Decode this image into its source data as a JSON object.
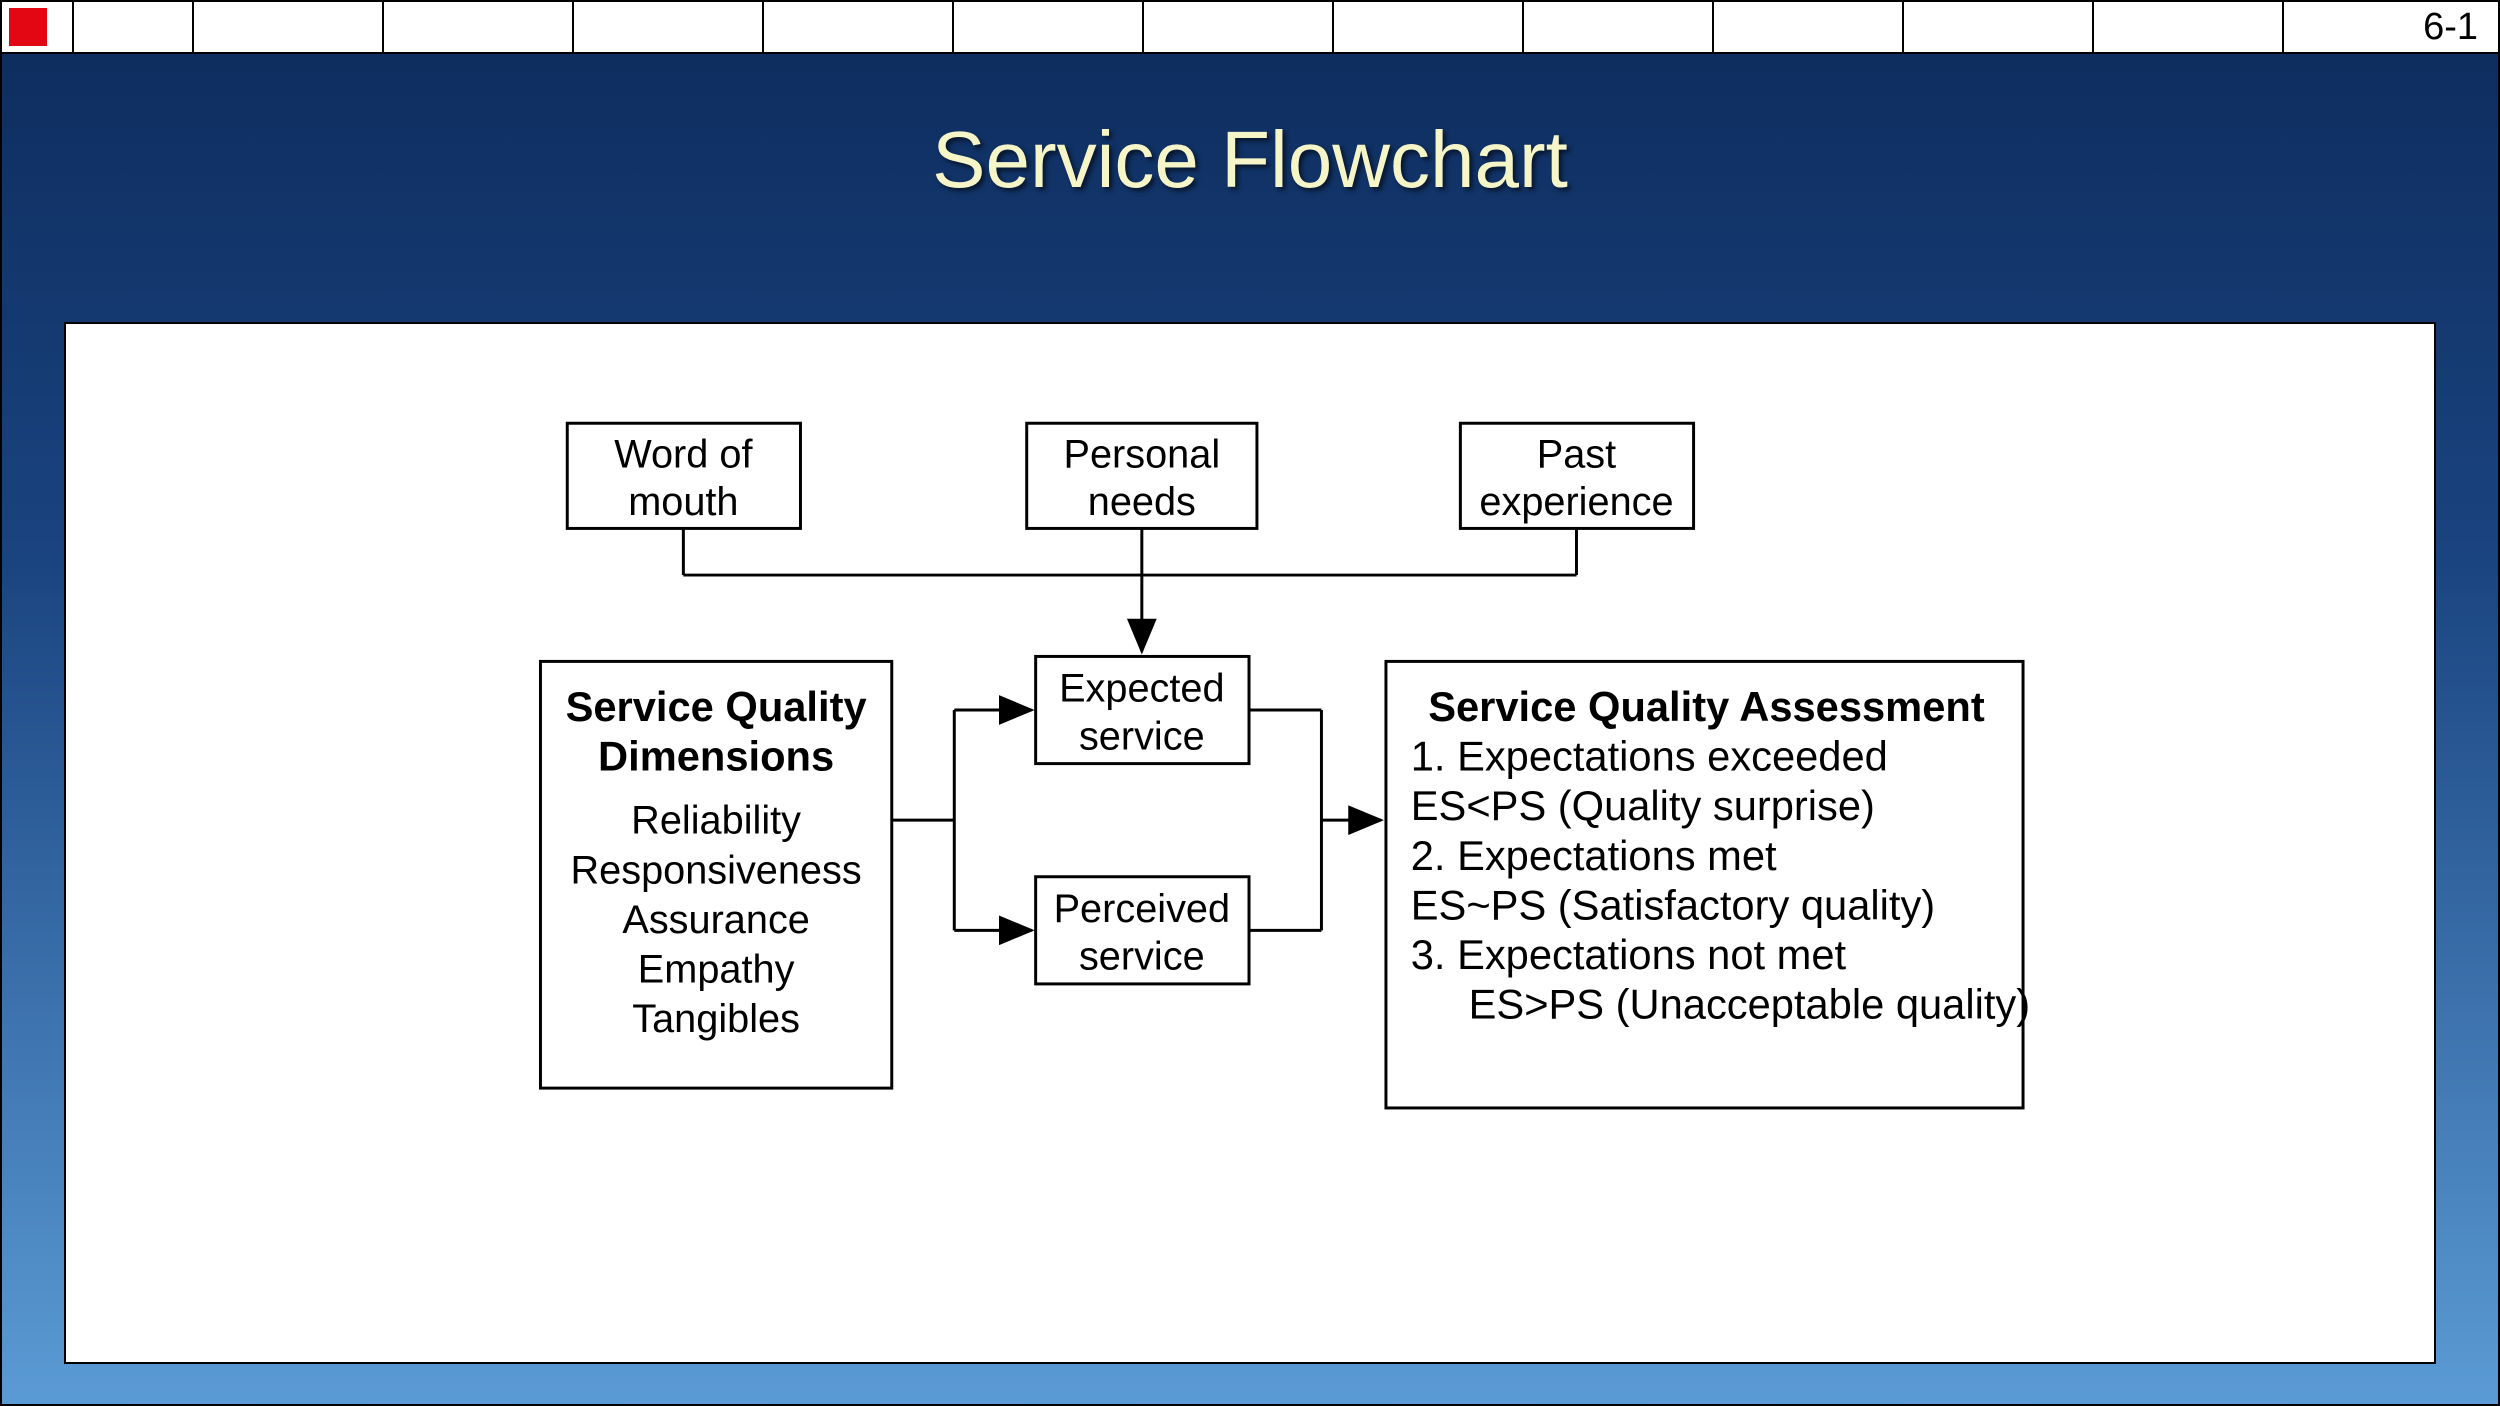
{
  "page_number": "6-1",
  "title": "Service Flowchart",
  "inputs": {
    "box1_line1": "Word of",
    "box1_line2": "mouth",
    "box2_line1": "Personal",
    "box2_line2": "needs",
    "box3_line1": "Past",
    "box3_line2": "experience"
  },
  "dimensions": {
    "title1": "Service Quality",
    "title2": "Dimensions",
    "item1": "Reliability",
    "item2": "Responsiveness",
    "item3": "Assurance",
    "item4": "Empathy",
    "item5": "Tangibles"
  },
  "middle": {
    "expected1": "Expected",
    "expected2": "service",
    "perceived1": "Perceived",
    "perceived2": "service"
  },
  "assessment": {
    "title": "Service Quality Assessment",
    "l1a": "1.  Expectations exceeded",
    "l1b": "     ES<PS (Quality surprise)",
    "l2a": "2.  Expectations met",
    "l2b": "     ES~PS (Satisfactory quality)",
    "l3a": "3.  Expectations not met",
    "l3b": "     ES>PS (Unacceptable quality)"
  }
}
